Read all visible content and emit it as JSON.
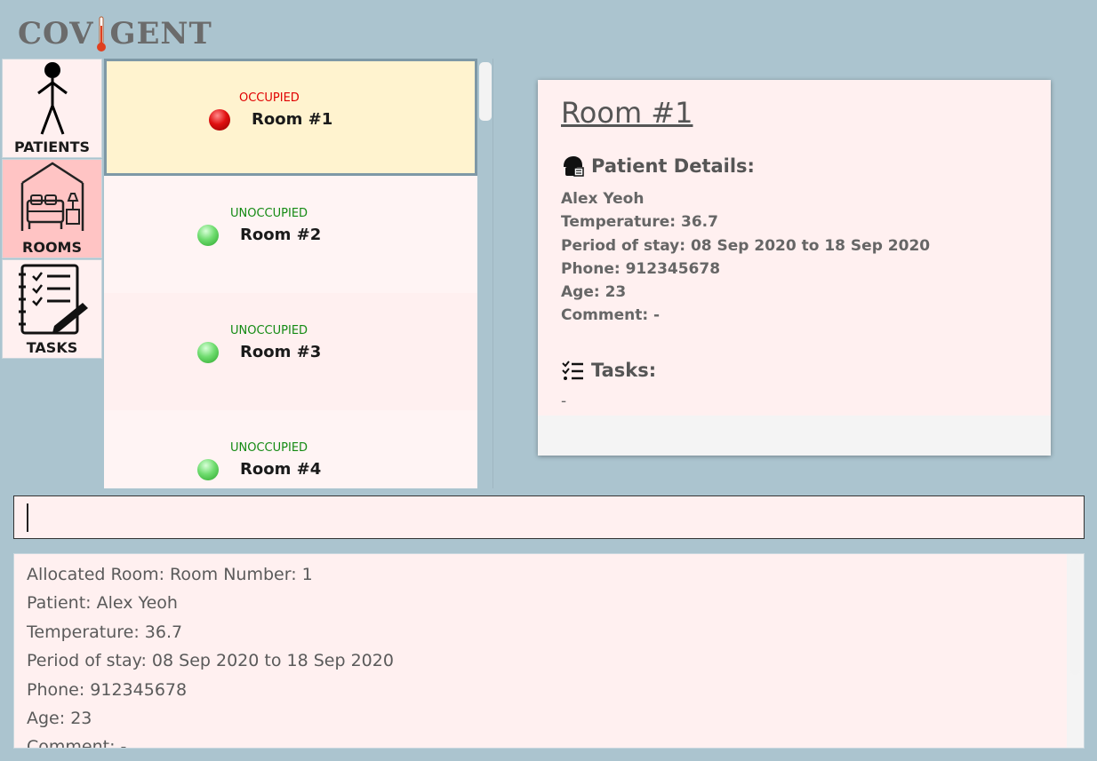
{
  "app": {
    "logo_left": "COV",
    "logo_right": "GENT"
  },
  "nav": [
    {
      "label": "PATIENTS",
      "icon": "person-icon",
      "active": false
    },
    {
      "label": "ROOMS",
      "icon": "bed-room-icon",
      "active": true
    },
    {
      "label": "TASKS",
      "icon": "checklist-icon",
      "active": false
    }
  ],
  "rooms": [
    {
      "status": "OCCUPIED",
      "name": "Room #1",
      "color": "#e00000"
    },
    {
      "status": "UNOCCUPIED",
      "name": "Room #2",
      "color": "#138a13"
    },
    {
      "status": "UNOCCUPIED",
      "name": "Room #3",
      "color": "#138a13"
    },
    {
      "status": "UNOCCUPIED",
      "name": "Room #4",
      "color": "#138a13"
    }
  ],
  "detail": {
    "title": "Room #1",
    "patient_heading": "Patient Details:",
    "patient_name": "Alex Yeoh",
    "temperature": "Temperature: 36.7",
    "period": "Period of stay: 08 Sep 2020 to 18 Sep 2020",
    "phone": "Phone: 912345678",
    "age": "Age: 23",
    "comment": "Comment: -",
    "tasks_heading": "Tasks:",
    "tasks_value": "-"
  },
  "command": {
    "value": ""
  },
  "result": {
    "lines": [
      "Allocated Room: Room Number: 1",
      "Patient: Alex Yeoh",
      "Temperature: 36.7",
      "Period of stay: 08 Sep 2020 to 18 Sep 2020",
      "Phone: 912345678",
      "Age: 23",
      "Comment: -"
    ]
  }
}
